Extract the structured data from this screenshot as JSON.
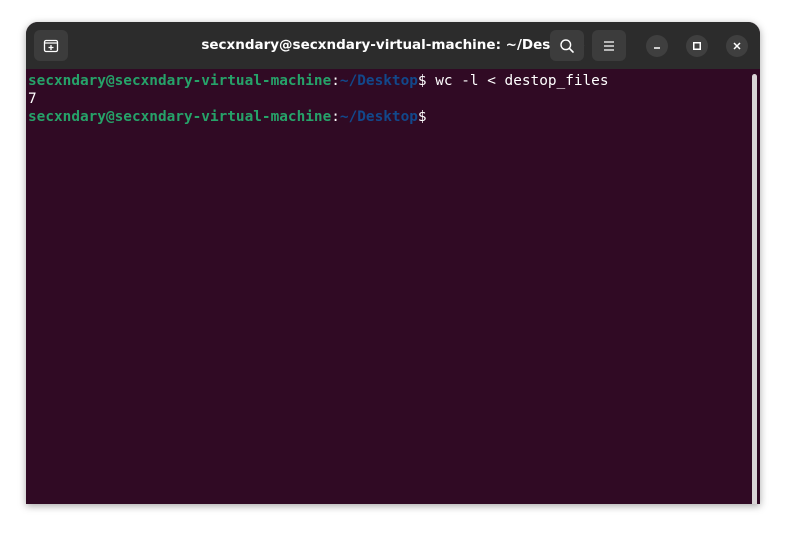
{
  "window": {
    "title": "secxndary@secxndary-virtual-machine: ~/Desktop"
  },
  "header": {
    "new_tab_icon": "new-tab-icon",
    "search_icon": "search-icon",
    "menu_icon": "hamburger-menu-icon",
    "minimize_icon": "minimize-icon",
    "maximize_icon": "maximize-icon",
    "close_icon": "close-icon"
  },
  "terminal": {
    "lines": [
      {
        "user": "secxndary@secxndary-virtual-machine",
        "sep": ":",
        "path": "~/Desktop",
        "prompt": "$ ",
        "command": "wc -l < destop_files"
      },
      {
        "output": "7"
      },
      {
        "user": "secxndary@secxndary-virtual-machine",
        "sep": ":",
        "path": "~/Desktop",
        "prompt": "$",
        "command": ""
      }
    ]
  },
  "colors": {
    "terminal_background": "#300a24",
    "titlebar_background": "#2c2c2c",
    "prompt_user": "#26a269",
    "prompt_path": "#12488b",
    "text": "#ffffff"
  }
}
